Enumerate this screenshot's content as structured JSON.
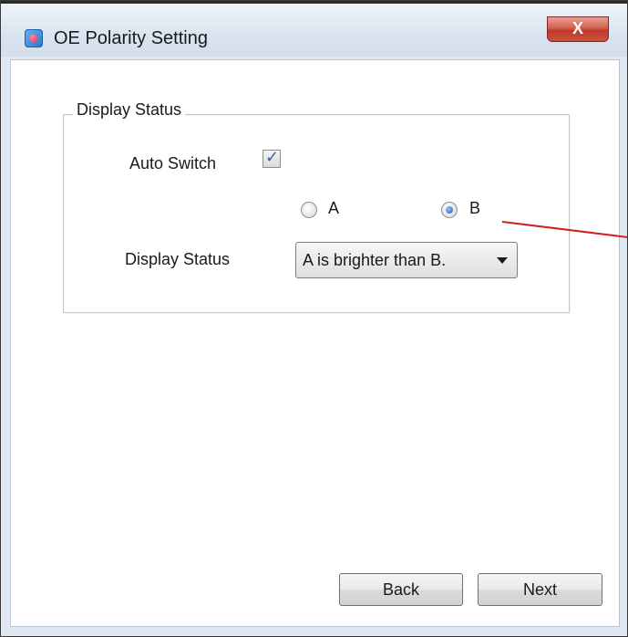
{
  "window": {
    "title": "OE Polarity Setting",
    "close_glyph": "X",
    "icon": "app-icon"
  },
  "group": {
    "title": "Display Status"
  },
  "auto_switch": {
    "label": "Auto Switch",
    "checked": true,
    "check_glyph": "✓"
  },
  "radios": [
    {
      "label": "A",
      "checked": false
    },
    {
      "label": "B",
      "checked": true
    }
  ],
  "display_status": {
    "label": "Display Status",
    "selected": "A is brighter than B."
  },
  "buttons": {
    "back": "Back",
    "next": "Next"
  },
  "colors": {
    "annotation_line": "#d21f1f",
    "close_button": "#c0392b"
  }
}
